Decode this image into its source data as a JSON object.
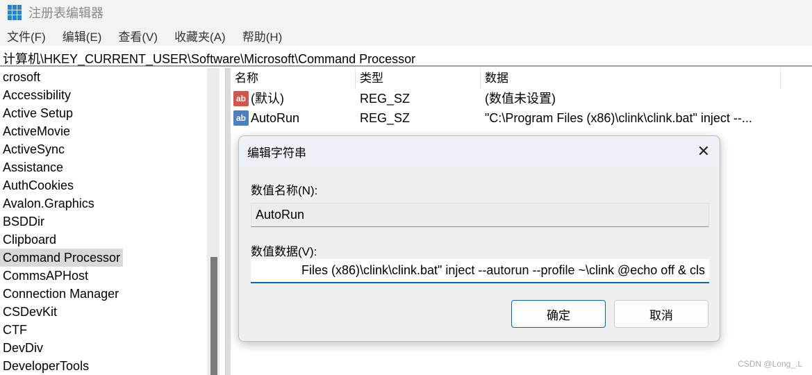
{
  "window": {
    "title": "注册表编辑器",
    "icon": "registry-icon"
  },
  "menu": [
    "文件(F)",
    "编辑(E)",
    "查看(V)",
    "收藏夹(A)",
    "帮助(H)"
  ],
  "address": "计算机\\HKEY_CURRENT_USER\\Software\\Microsoft\\Command Processor",
  "tree": {
    "items": [
      "crosoft",
      "Accessibility",
      "Active Setup",
      "ActiveMovie",
      "ActiveSync",
      "Assistance",
      "AuthCookies",
      "Avalon.Graphics",
      "BSDDir",
      "Clipboard",
      "Command Processor",
      "CommsAPHost",
      "Connection Manager",
      "CSDevKit",
      "CTF",
      "DevDiv",
      "DeveloperTools"
    ],
    "selected": "Command Processor"
  },
  "list": {
    "columns": [
      "名称",
      "类型",
      "数据"
    ],
    "rows": [
      {
        "name": "(默认)",
        "type": "REG_SZ",
        "data": "(数值未设置)",
        "icon": "string-value-icon",
        "color": "#d9534f"
      },
      {
        "name": "AutoRun",
        "type": "REG_SZ",
        "data": "\"C:\\Program Files (x86)\\clink\\clink.bat\" inject --...",
        "icon": "string-value-icon",
        "color": "#4a7fc0"
      }
    ]
  },
  "dialog": {
    "title": "编辑字符串",
    "name_label": "数值名称(N):",
    "name_value": "AutoRun",
    "data_label": "数值数据(V):",
    "data_value": "Files (x86)\\clink\\clink.bat\" inject --autorun --profile ~\\clink @echo off & cls",
    "ok": "确定",
    "cancel": "取消"
  },
  "watermark": "CSDN @Long_.L"
}
